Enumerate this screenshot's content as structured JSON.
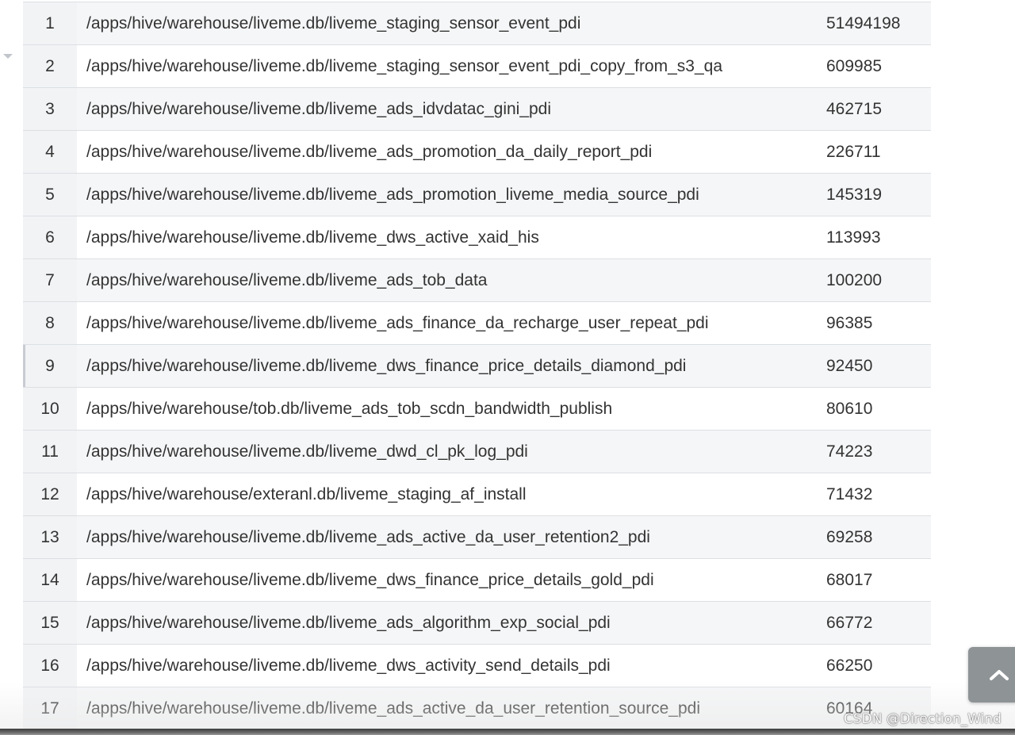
{
  "table": {
    "rows": [
      {
        "index": "1",
        "path": "/apps/hive/warehouse/liveme.db/liveme_staging_sensor_event_pdi",
        "count": "51494198"
      },
      {
        "index": "2",
        "path": "/apps/hive/warehouse/liveme.db/liveme_staging_sensor_event_pdi_copy_from_s3_qa",
        "count": "609985"
      },
      {
        "index": "3",
        "path": "/apps/hive/warehouse/liveme.db/liveme_ads_idvdatac_gini_pdi",
        "count": "462715"
      },
      {
        "index": "4",
        "path": "/apps/hive/warehouse/liveme.db/liveme_ads_promotion_da_daily_report_pdi",
        "count": "226711"
      },
      {
        "index": "5",
        "path": "/apps/hive/warehouse/liveme.db/liveme_ads_promotion_liveme_media_source_pdi",
        "count": "145319"
      },
      {
        "index": "6",
        "path": "/apps/hive/warehouse/liveme.db/liveme_dws_active_xaid_his",
        "count": "113993"
      },
      {
        "index": "7",
        "path": "/apps/hive/warehouse/liveme.db/liveme_ads_tob_data",
        "count": "100200"
      },
      {
        "index": "8",
        "path": "/apps/hive/warehouse/liveme.db/liveme_ads_finance_da_recharge_user_repeat_pdi",
        "count": "96385"
      },
      {
        "index": "9",
        "path": "/apps/hive/warehouse/liveme.db/liveme_dws_finance_price_details_diamond_pdi",
        "count": "92450"
      },
      {
        "index": "10",
        "path": "/apps/hive/warehouse/tob.db/liveme_ads_tob_scdn_bandwidth_publish",
        "count": "80610"
      },
      {
        "index": "11",
        "path": "/apps/hive/warehouse/liveme.db/liveme_dwd_cl_pk_log_pdi",
        "count": "74223"
      },
      {
        "index": "12",
        "path": "/apps/hive/warehouse/exteranl.db/liveme_staging_af_install",
        "count": "71432"
      },
      {
        "index": "13",
        "path": "/apps/hive/warehouse/liveme.db/liveme_ads_active_da_user_retention2_pdi",
        "count": "69258"
      },
      {
        "index": "14",
        "path": "/apps/hive/warehouse/liveme.db/liveme_dws_finance_price_details_gold_pdi",
        "count": "68017"
      },
      {
        "index": "15",
        "path": "/apps/hive/warehouse/liveme.db/liveme_ads_algorithm_exp_social_pdi",
        "count": "66772"
      },
      {
        "index": "16",
        "path": "/apps/hive/warehouse/liveme.db/liveme_dws_activity_send_details_pdi",
        "count": "66250"
      },
      {
        "index": "17",
        "path": "/apps/hive/warehouse/liveme.db/liveme_ads_active_da_user_retention_source_pdi",
        "count": "60164"
      }
    ]
  },
  "icons": {
    "collapse": "caret-down-icon",
    "scroll_top": "chevron-up-icon"
  },
  "watermark": "CSDN @Direction_Wind",
  "colors": {
    "index_column_bg": "#f2f3f5",
    "row_alt_bg": "#f5f6f7",
    "text": "#333333",
    "scroll_button_bg": "#8e9396"
  }
}
